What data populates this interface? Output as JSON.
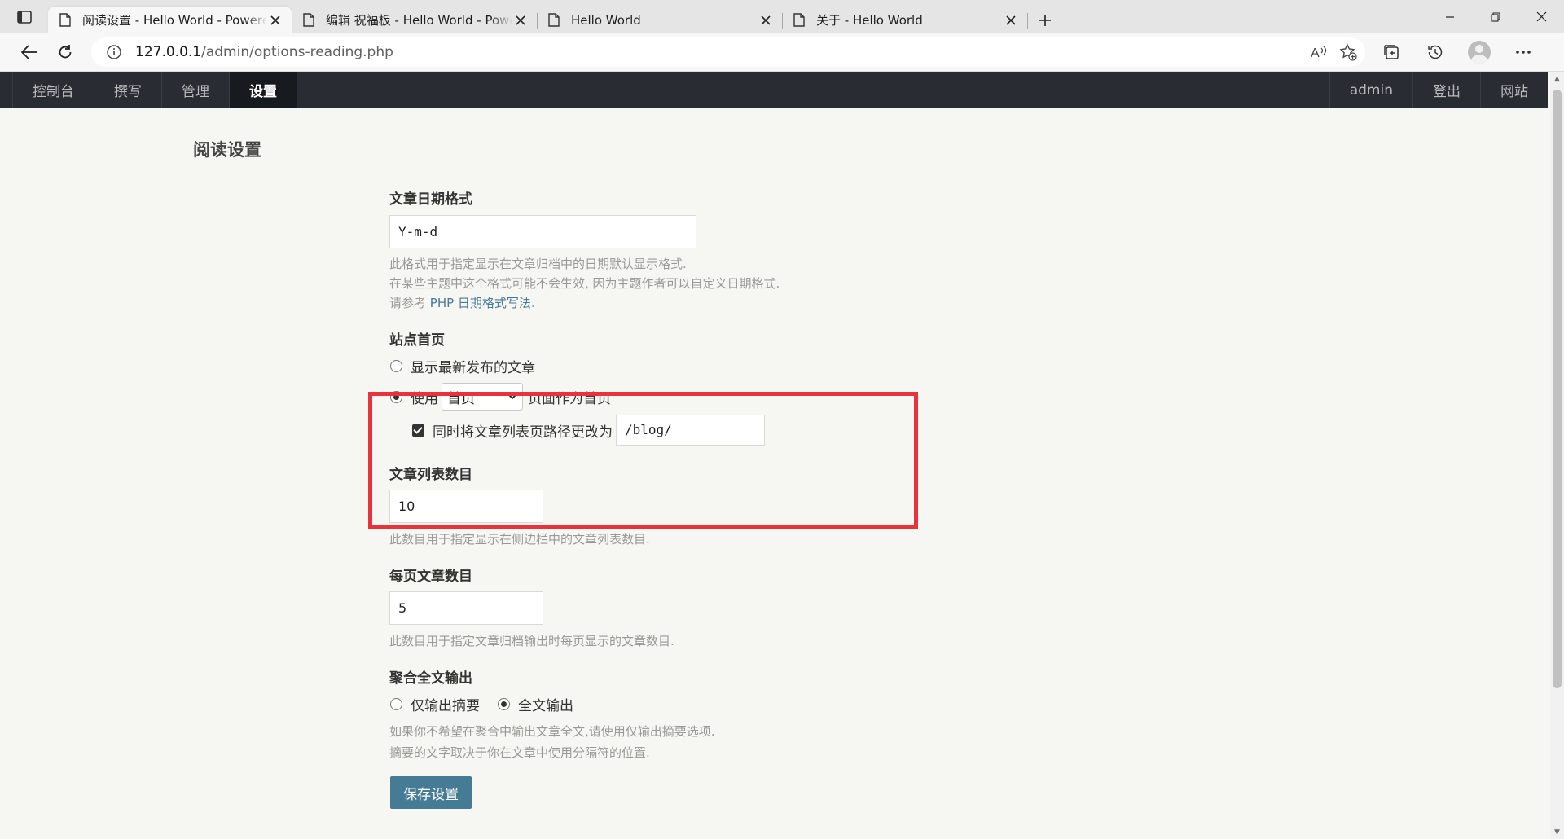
{
  "browser": {
    "tabs": [
      {
        "title": "阅读设置 - Hello World - Powered by Typecho",
        "active": true
      },
      {
        "title": "编辑 祝福板 - Hello World - Powered by Typecho",
        "active": false
      },
      {
        "title": "Hello World",
        "active": false
      },
      {
        "title": "关于 - Hello World",
        "active": false
      }
    ],
    "url_host": "127.0.0.1",
    "url_path": "/admin/options-reading.php"
  },
  "admin_nav": {
    "left": [
      "控制台",
      "撰写",
      "管理",
      "设置"
    ],
    "active": "设置",
    "right": [
      "admin",
      "登出",
      "网站"
    ]
  },
  "page": {
    "title": "阅读设置",
    "date_format": {
      "label": "文章日期格式",
      "value": "Y-m-d",
      "desc1": "此格式用于指定显示在文章归档中的日期默认显示格式.",
      "desc2": "在某些主题中这个格式可能不会生效, 因为主题作者可以自定义日期格式.",
      "desc3_prefix": "请参考 ",
      "desc3_link": "PHP 日期格式写法",
      "desc3_suffix": "."
    },
    "front_page": {
      "label": "站点首页",
      "option_latest": "显示最新发布的文章",
      "option_use": "使用",
      "page_select": "首页",
      "option_use_suffix": "页面作为首页",
      "checkbox_label": "同时将文章列表页路径更改为",
      "path_value": "/blog/",
      "selected": "use_page",
      "checkbox_checked": true
    },
    "list_count": {
      "label": "文章列表数目",
      "value": "10",
      "desc": "此数目用于指定显示在侧边栏中的文章列表数目."
    },
    "page_size": {
      "label": "每页文章数目",
      "value": "5",
      "desc": "此数目用于指定文章归档输出时每页显示的文章数目."
    },
    "feed_full": {
      "label": "聚合全文输出",
      "option_excerpt": "仅输出摘要",
      "option_full": "全文输出",
      "selected": "full",
      "desc1": "如果你不希望在聚合中输出文章全文,请使用仅输出摘要选项.",
      "desc2": "摘要的文字取决于你在文章中使用分隔符的位置."
    },
    "save_label": "保存设置"
  },
  "colors": {
    "nav_bg": "#292d33",
    "accent": "#467b96",
    "highlight": "#e8323c"
  }
}
